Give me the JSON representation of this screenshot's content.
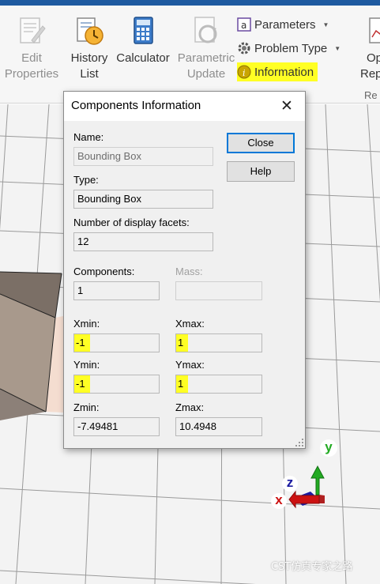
{
  "ribbon": {
    "edit_properties": "Edit\nProperties",
    "history_list": "History\nList",
    "calculator": "Calculator",
    "parametric_update": "Parametric\nUpdate",
    "parameters": "Parameters",
    "problem_type": "Problem Type",
    "information": "Information",
    "op_label": "Op",
    "rep_label": "Rep",
    "rep_group": "Re"
  },
  "dialog": {
    "title": "Components Information",
    "close_button": "Close",
    "help_button": "Help",
    "name_label": "Name:",
    "name_value": "Bounding Box",
    "type_label": "Type:",
    "type_value": "Bounding Box",
    "facets_label": "Number of display facets:",
    "facets_value": "12",
    "components_label": "Components:",
    "components_value": "1",
    "mass_label": "Mass:",
    "mass_value": "",
    "xmin_label": "Xmin:",
    "xmin_value": "-1",
    "xmax_label": "Xmax:",
    "xmax_value": "1",
    "ymin_label": "Ymin:",
    "ymin_value": "-1",
    "ymax_label": "Ymax:",
    "ymax_value": "1",
    "zmin_label": "Zmin:",
    "zmin_value": "-7.49481",
    "zmax_label": "Zmax:",
    "zmax_value": "10.4948"
  },
  "axes": {
    "x": "x",
    "y": "y",
    "z": "z"
  },
  "watermark": "CST仿真专家之路",
  "colors": {
    "highlight": "#ffff24",
    "accent": "#0078d7",
    "axis_x": "#cc1111",
    "axis_y": "#22aa22",
    "axis_z": "#1a1aa0"
  }
}
